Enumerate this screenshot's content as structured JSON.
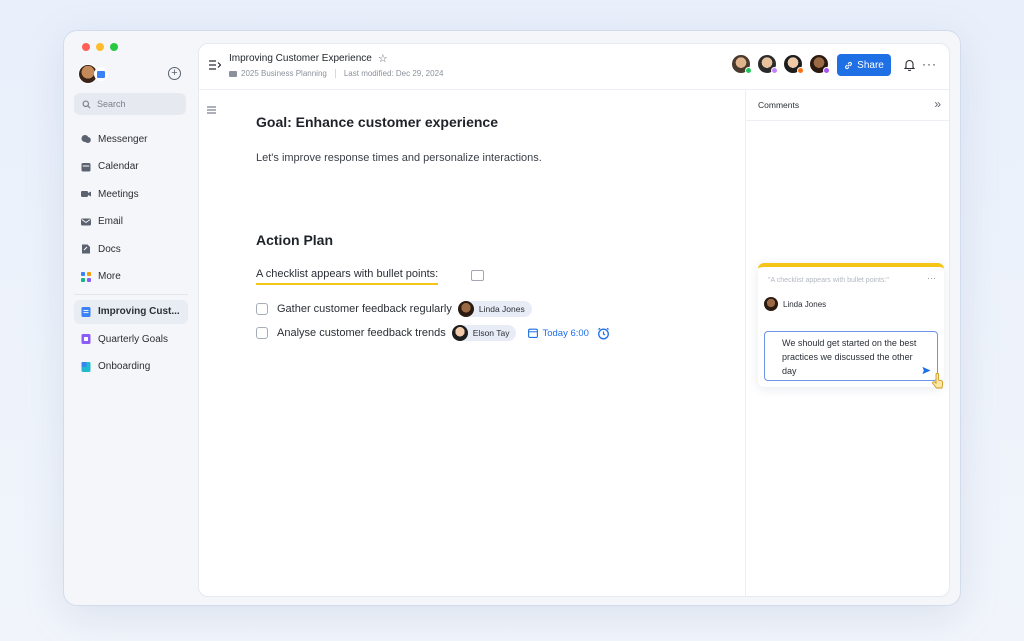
{
  "colors": {
    "accent": "#1f6fe5",
    "highlight": "#f5c518",
    "traffic_red": "#ff5f57",
    "traffic_yellow": "#febc2e",
    "traffic_green": "#28c840"
  },
  "sidebar": {
    "search_placeholder": "Search",
    "nav": [
      {
        "label": "Messenger",
        "icon": "chat-icon"
      },
      {
        "label": "Calendar",
        "icon": "calendar-icon"
      },
      {
        "label": "Meetings",
        "icon": "video-icon"
      },
      {
        "label": "Email",
        "icon": "mail-icon"
      },
      {
        "label": "Docs",
        "icon": "docs-icon"
      },
      {
        "label": "More",
        "icon": "grid-icon"
      }
    ],
    "docs": [
      {
        "label": "Improving Cust...",
        "icon": "doc-icon",
        "active": true
      },
      {
        "label": "Quarterly Goals",
        "icon": "doc-icon"
      },
      {
        "label": "Onboarding",
        "icon": "doc-icon"
      }
    ]
  },
  "header": {
    "title": "Improving Customer Experience",
    "folder": "2025 Business Planning",
    "last_modified": "Last modified: Dec 29, 2024",
    "share_label": "Share"
  },
  "document": {
    "goal_heading": "Goal: Enhance customer experience",
    "goal_text": "Let's improve response times and personalize interactions.",
    "plan_heading": "Action Plan",
    "checklist_title": "A checklist appears with bullet points:",
    "tasks": [
      {
        "text": "Gather customer feedback regularly",
        "assignee": "Linda Jones"
      },
      {
        "text": "Analyse customer feedback trends",
        "assignee": "Elson Tay",
        "due": "Today 6:00"
      }
    ]
  },
  "comments": {
    "title": "Comments",
    "quote": "\"A checklist appears with bullet points:\"",
    "author": "Linda Jones",
    "reply_text": "We should get started on the best practices we discussed the other day"
  }
}
